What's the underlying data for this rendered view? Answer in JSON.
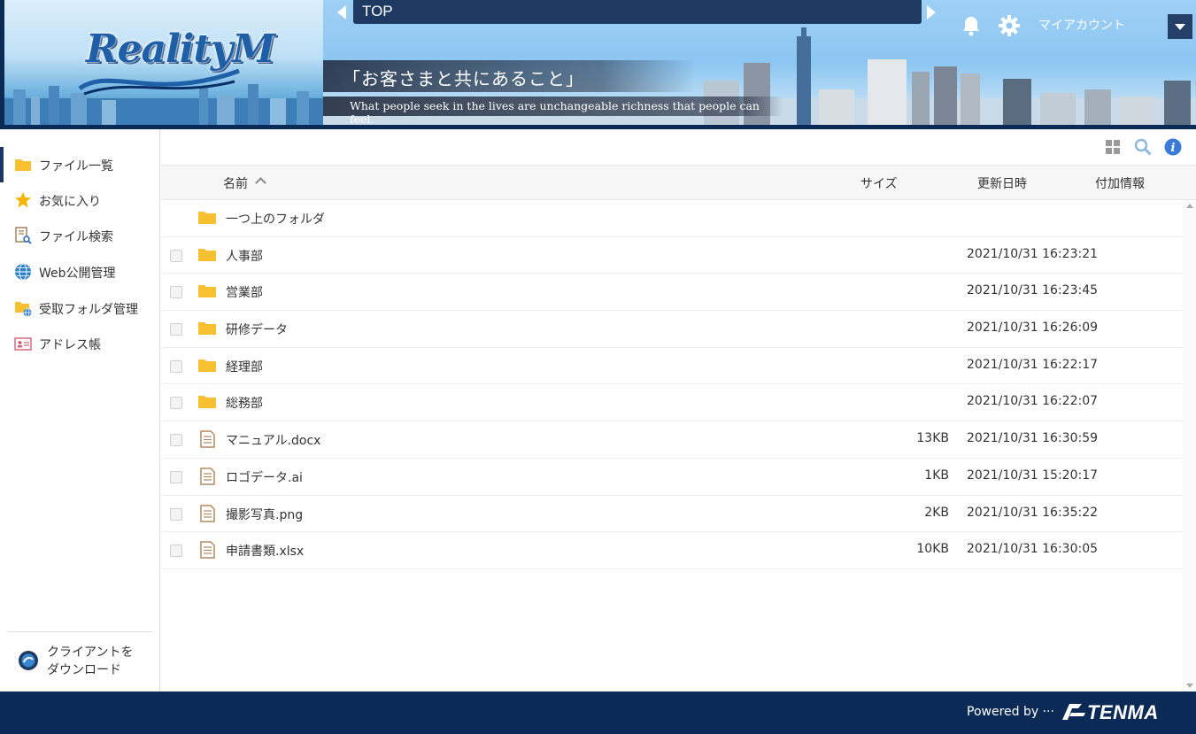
{
  "header": {
    "logo_text": "RealityM",
    "breadcrumb": "TOP",
    "slogan": "「お客さまと共にあること」",
    "tagline": "What people seek in the lives are unchangeable richness that people can feel.",
    "account_label": "マイアカウント"
  },
  "sidebar": {
    "items": [
      {
        "label": "ファイル一覧",
        "icon": "folder-icon"
      },
      {
        "label": "お気に入り",
        "icon": "star-icon"
      },
      {
        "label": "ファイル検索",
        "icon": "file-search-icon"
      },
      {
        "label": "Web公開管理",
        "icon": "globe-icon"
      },
      {
        "label": "受取フォルダ管理",
        "icon": "receive-folder-icon"
      },
      {
        "label": "アドレス帳",
        "icon": "address-card-icon"
      }
    ],
    "client_download": "クライアントを\nダウンロード"
  },
  "table": {
    "columns": {
      "name": "名前",
      "size": "サイズ",
      "updated": "更新日時",
      "extra": "付加情報"
    },
    "parent_folder": "一つ上のフォルダ",
    "rows": [
      {
        "name": "人事部",
        "type": "folder",
        "size": "",
        "updated": "2021/10/31 16:23:21"
      },
      {
        "name": "営業部",
        "type": "folder",
        "size": "",
        "updated": "2021/10/31 16:23:45"
      },
      {
        "name": "研修データ",
        "type": "folder",
        "size": "",
        "updated": "2021/10/31 16:26:09"
      },
      {
        "name": "経理部",
        "type": "folder",
        "size": "",
        "updated": "2021/10/31 16:22:17"
      },
      {
        "name": "総務部",
        "type": "folder",
        "size": "",
        "updated": "2021/10/31 16:22:07"
      },
      {
        "name": "マニュアル.docx",
        "type": "file",
        "size": "13KB",
        "updated": "2021/10/31 16:30:59"
      },
      {
        "name": "ロゴデータ.ai",
        "type": "file",
        "size": "1KB",
        "updated": "2021/10/31 15:20:17"
      },
      {
        "name": "撮影写真.png",
        "type": "file",
        "size": "2KB",
        "updated": "2021/10/31 16:35:22"
      },
      {
        "name": "申請書類.xlsx",
        "type": "file",
        "size": "10KB",
        "updated": "2021/10/31 16:30:05"
      }
    ]
  },
  "footer": {
    "powered_by": "Powered by ···",
    "brand": "TENMA"
  },
  "colors": {
    "navy": "#0b2a55",
    "folder": "#f7c030",
    "accent_blue": "#3a7bd5"
  }
}
